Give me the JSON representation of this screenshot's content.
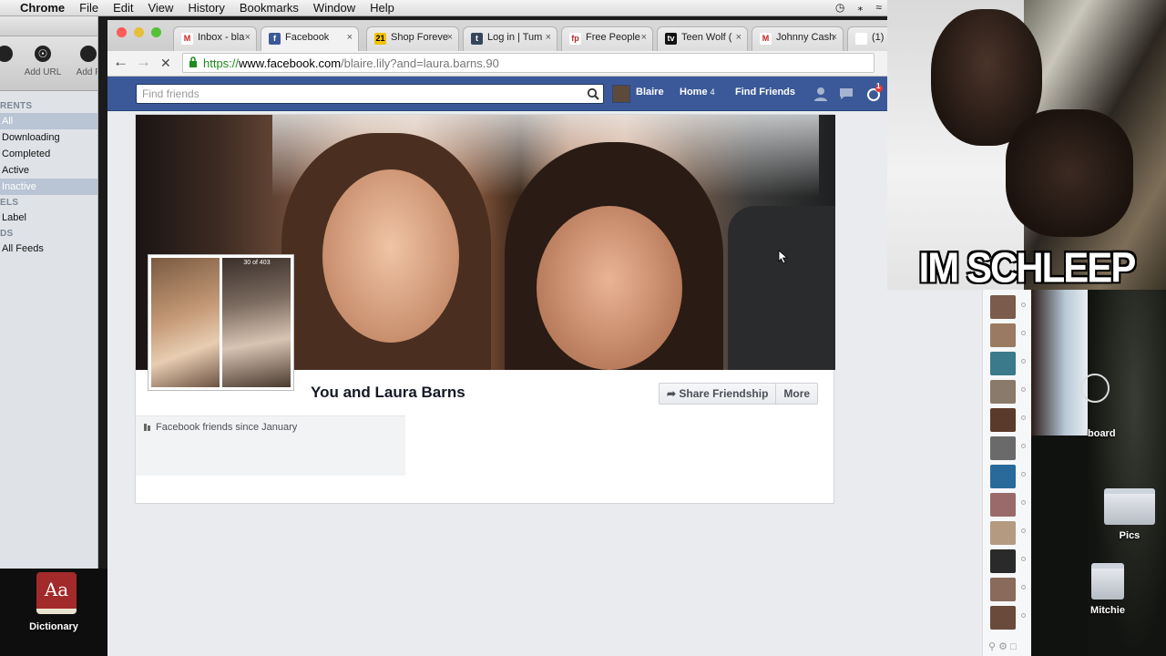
{
  "menubar": {
    "items": [
      "Chrome",
      "File",
      "Edit",
      "View",
      "History",
      "Bookmarks",
      "Window",
      "Help"
    ]
  },
  "left_app": {
    "toolbar": [
      "Add URL",
      "Add F"
    ],
    "section_torrents": "RENTS",
    "items": [
      "All",
      "Downloading",
      "Completed",
      "Active",
      "Inactive"
    ],
    "section_labels": "ELS",
    "label_item": "Label",
    "section_feeds": "DS",
    "feeds_item": "All Feeds"
  },
  "dock": {
    "dictionary_glyph": "Aa",
    "dictionary_label": "Dictionary"
  },
  "browser": {
    "tabs": [
      {
        "label": "Inbox - bla",
        "fav_color": "#ffffff",
        "fav_text": "M",
        "fav_text_color": "#c5221f"
      },
      {
        "label": "Facebook",
        "fav_color": "#3b5998",
        "fav_text": "f",
        "fav_text_color": "#ffffff"
      },
      {
        "label": "Shop Foreve",
        "fav_color": "#f2c200",
        "fav_text": "21",
        "fav_text_color": "#000000"
      },
      {
        "label": "Log in | Tum",
        "fav_color": "#35465c",
        "fav_text": "t",
        "fav_text_color": "#ffffff"
      },
      {
        "label": "Free People",
        "fav_color": "#ffffff",
        "fav_text": "fp",
        "fav_text_color": "#b02a2a"
      },
      {
        "label": "Teen Wolf (",
        "fav_color": "#111111",
        "fav_text": "tv",
        "fav_text_color": "#ffffff"
      },
      {
        "label": "Johnny Cash",
        "fav_color": "#ffffff",
        "fav_text": "M",
        "fav_text_color": "#c5221f"
      },
      {
        "label": "(1)",
        "fav_color": "#ffffff",
        "fav_text": "",
        "fav_text_color": "#000000"
      }
    ],
    "url_scheme": "https://",
    "url_host": "www.facebook.com",
    "url_path": "/blaire.lily?and=laura.barns.90"
  },
  "facebook": {
    "search_placeholder": "Find friends",
    "nav_user": "Blaire",
    "nav_home": "Home",
    "nav_home_count": "4",
    "nav_find_friends": "Find Friends",
    "notification_count": "1",
    "thumb_caption": "30 of 403",
    "friendship_title": "You and Laura Barns",
    "share_button": "Share Friendship",
    "more_button": "More",
    "friends_since": "Facebook friends since January"
  },
  "meme": {
    "caption": "IM SCHLEEP"
  },
  "desktop": {
    "partial_label": "board",
    "folder1": "Pics",
    "folder2": "Mitchie"
  },
  "colors": {
    "facebook_blue": "#3b5998",
    "secure_green": "#1e8a1e"
  }
}
